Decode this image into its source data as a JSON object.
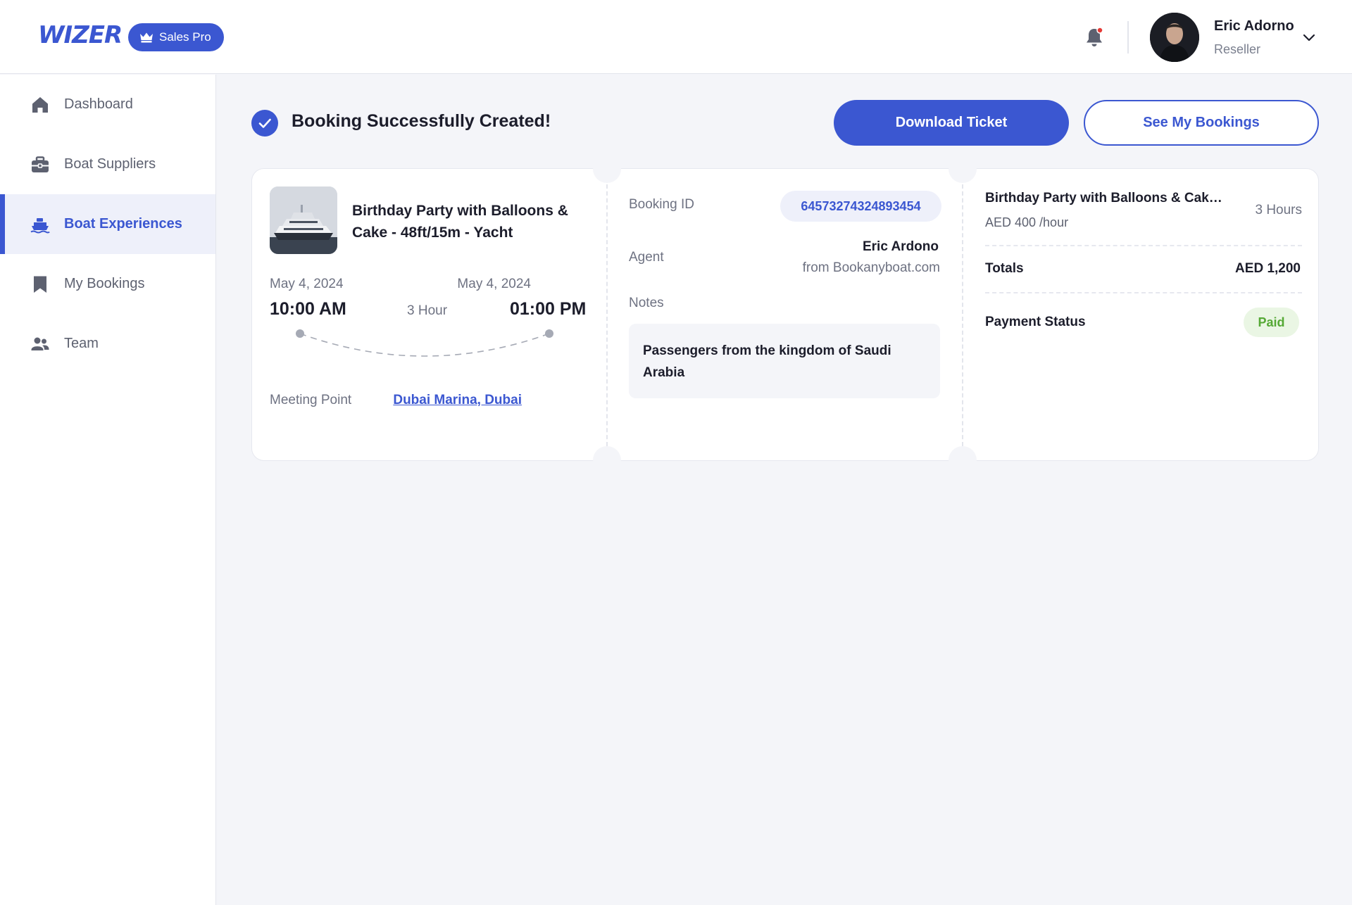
{
  "header": {
    "logo": "WIZER",
    "badge_label": "Sales Pro",
    "user": {
      "name": "Eric Adorno",
      "role": "Reseller"
    }
  },
  "sidebar": {
    "items": [
      {
        "label": "Dashboard",
        "icon": "home-icon",
        "active": false
      },
      {
        "label": "Boat Suppliers",
        "icon": "briefcase-icon",
        "active": false
      },
      {
        "label": "Boat Experiences",
        "icon": "ship-icon",
        "active": true
      },
      {
        "label": "My Bookings",
        "icon": "bookmark-icon",
        "active": false
      },
      {
        "label": "Team",
        "icon": "users-icon",
        "active": false
      }
    ]
  },
  "status": {
    "message": "Booking Successfully Created!",
    "download_label": "Download Ticket",
    "bookings_label": "See My Bookings"
  },
  "ticket": {
    "experience_title": "Birthday Party with Balloons & Cake - 48ft/15m - Yacht",
    "start_date": "May 4, 2024",
    "end_date": "May 4, 2024",
    "start_time": "10:00 AM",
    "end_time": "01:00 PM",
    "duration": "3 Hour",
    "meeting_point_label": "Meeting Point",
    "meeting_point": "Dubai Marina, Dubai",
    "booking_id_label": "Booking ID",
    "booking_id": "64573274324893454",
    "agent_label": "Agent",
    "agent_name": "Eric Ardono",
    "agent_from": "from Bookanyboat.com",
    "notes_label": "Notes",
    "notes": "Passengers from the kingdom of Saudi Arabia"
  },
  "summary": {
    "item_title": "Birthday Party with Balloons & Cake...",
    "rate": "AED 400 /hour",
    "hours": "3 Hours",
    "totals_label": "Totals",
    "totals_value": "AED 1,200",
    "payment_label": "Payment Status",
    "payment_status": "Paid"
  },
  "colors": {
    "accent": "#3b57d1",
    "paid_bg": "#eaf6e4",
    "paid_text": "#55a935",
    "notification_dot": "#e53935"
  }
}
